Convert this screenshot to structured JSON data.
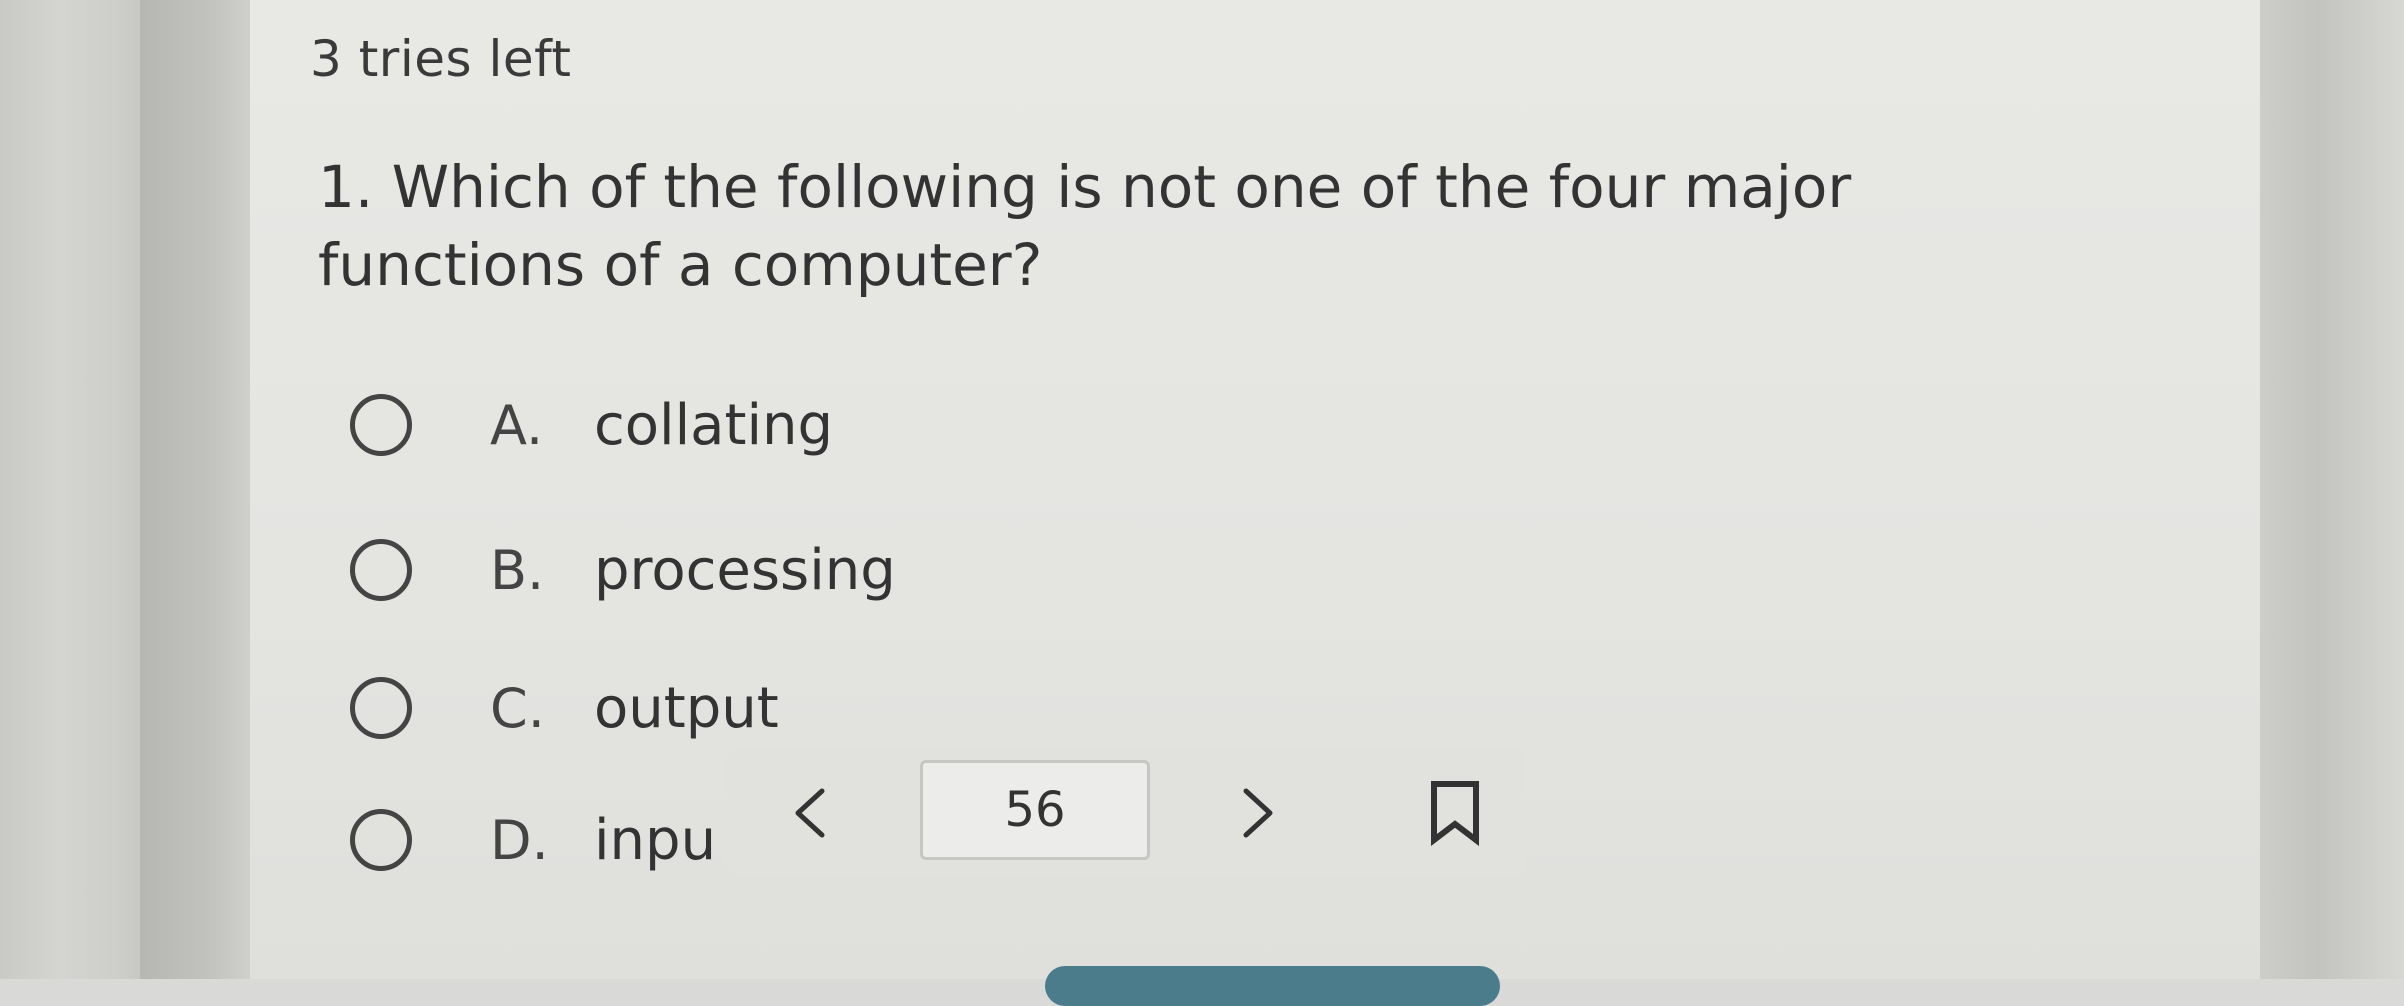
{
  "status": {
    "tries_left": "3 tries left"
  },
  "question": {
    "text": "1. Which of the following is not one of the four major functions of a computer?"
  },
  "options": [
    {
      "letter": "A.",
      "text": "collating"
    },
    {
      "letter": "B.",
      "text": "processing"
    },
    {
      "letter": "C.",
      "text": "output"
    },
    {
      "letter": "D.",
      "text": "inpu"
    }
  ],
  "pager": {
    "page_number": "56",
    "prev_icon": "chevron-left-icon",
    "next_icon": "chevron-right-icon",
    "bookmark_icon": "bookmark-icon"
  }
}
